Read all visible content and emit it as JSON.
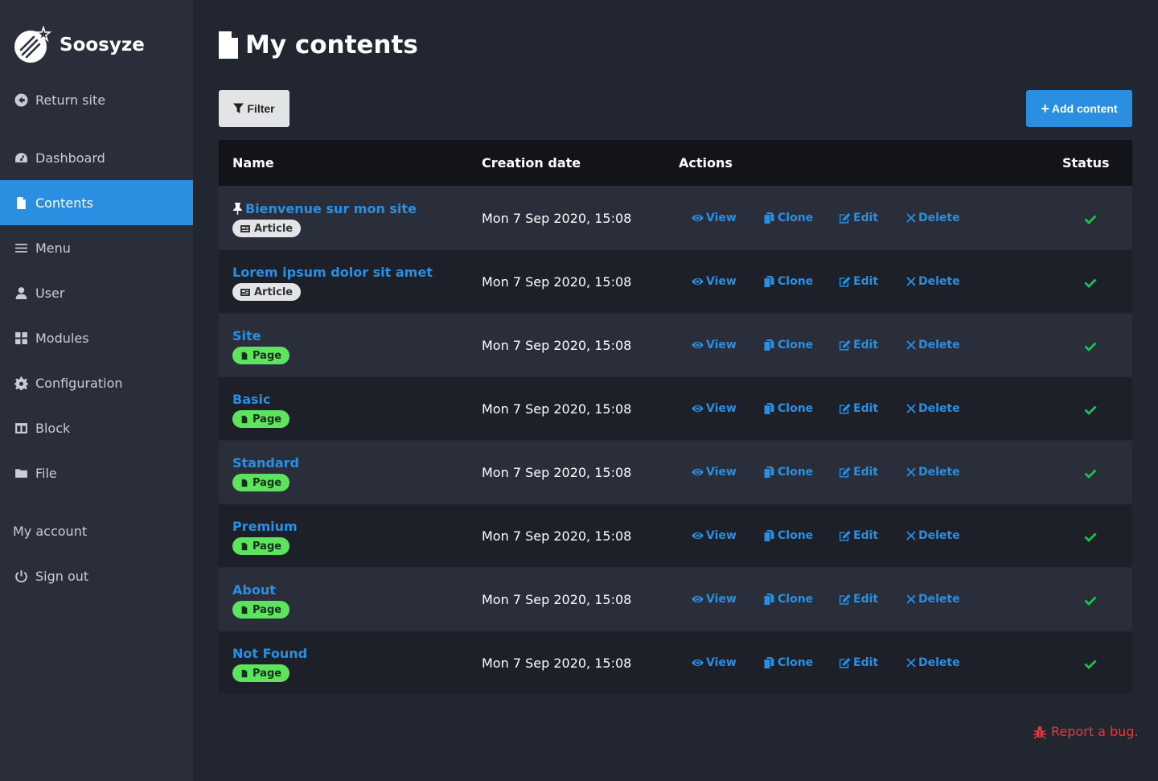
{
  "brand": {
    "name": "Soosyze"
  },
  "sidebar": {
    "return_site": "Return site",
    "items": [
      {
        "label": "Dashboard",
        "icon": "dashboard-icon"
      },
      {
        "label": "Contents",
        "icon": "file-icon",
        "active": true
      },
      {
        "label": "Menu",
        "icon": "bars-icon"
      },
      {
        "label": "User",
        "icon": "user-icon"
      },
      {
        "label": "Modules",
        "icon": "modules-icon"
      },
      {
        "label": "Configuration",
        "icon": "gear-icon"
      },
      {
        "label": "Block",
        "icon": "columns-icon"
      },
      {
        "label": "File",
        "icon": "folder-icon"
      }
    ],
    "my_account": "My account",
    "sign_out": "Sign out"
  },
  "main": {
    "title": "My contents",
    "filter_label": "Filter",
    "add_label": "Add content",
    "table": {
      "headers": {
        "name": "Name",
        "date": "Creation date",
        "actions": "Actions",
        "status": "Status"
      },
      "action_labels": {
        "view": "View",
        "clone": "Clone",
        "edit": "Edit",
        "delete": "Delete"
      },
      "rows": [
        {
          "title": "Bienvenue sur mon site",
          "type": "Article",
          "pinned": true,
          "date": "Mon 7 Sep 2020, 15:08"
        },
        {
          "title": "Lorem ipsum dolor sit amet",
          "type": "Article",
          "pinned": false,
          "date": "Mon 7 Sep 2020, 15:08"
        },
        {
          "title": "Site",
          "type": "Page",
          "pinned": false,
          "date": "Mon 7 Sep 2020, 15:08"
        },
        {
          "title": "Basic",
          "type": "Page",
          "pinned": false,
          "date": "Mon 7 Sep 2020, 15:08"
        },
        {
          "title": "Standard",
          "type": "Page",
          "pinned": false,
          "date": "Mon 7 Sep 2020, 15:08"
        },
        {
          "title": "Premium",
          "type": "Page",
          "pinned": false,
          "date": "Mon 7 Sep 2020, 15:08"
        },
        {
          "title": "About",
          "type": "Page",
          "pinned": false,
          "date": "Mon 7 Sep 2020, 15:08"
        },
        {
          "title": "Not Found",
          "type": "Page",
          "pinned": false,
          "date": "Mon 7 Sep 2020, 15:08"
        }
      ]
    },
    "report_bug": "Report a bug."
  },
  "colors": {
    "accent": "#2a8fe0",
    "page_badge": "#5de35d",
    "article_badge": "#e3e4e6",
    "status_ok": "#21c04a",
    "report": "#e5383b"
  }
}
